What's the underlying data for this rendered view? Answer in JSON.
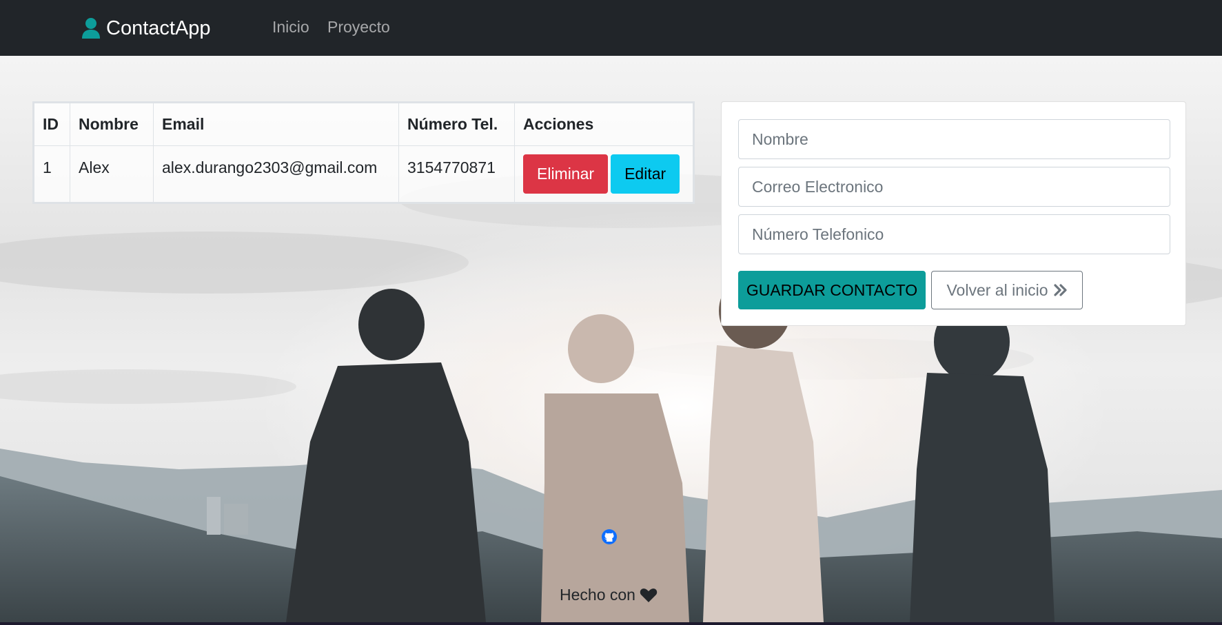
{
  "navbar": {
    "brand": "ContactApp",
    "brand_icon": "user-icon",
    "links": [
      "Inicio",
      "Proyecto"
    ]
  },
  "table": {
    "headers": [
      "ID",
      "Nombre",
      "Email",
      "Número Tel.",
      "Acciones"
    ],
    "rows": [
      {
        "id": "1",
        "nombre": "Alex",
        "email": "alex.durango2303@gmail.com",
        "numero": "3154770871",
        "delete_label": "Eliminar",
        "edit_label": "Editar"
      }
    ]
  },
  "form": {
    "nombre_placeholder": "Nombre",
    "correo_placeholder": "Correo Electronico",
    "numero_placeholder": "Número Telefonico",
    "save_label": "GUARDAR CONTACTO",
    "back_label": "Volver al inicio",
    "back_icon": "double-chevron-right-icon"
  },
  "footer": {
    "github_icon": "github-icon",
    "text": "Hecho con",
    "heart_icon": "heart-icon"
  },
  "colors": {
    "navbar": "#212529",
    "danger": "#dc3545",
    "info": "#0dcaf0",
    "teal": "#0d9d9a",
    "github_blue": "#0d6efd"
  }
}
